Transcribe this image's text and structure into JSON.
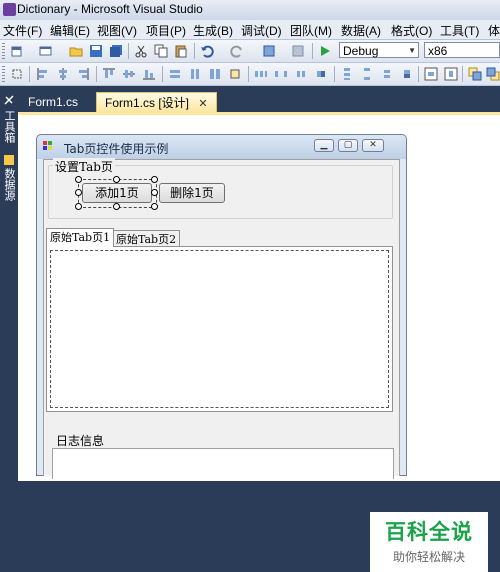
{
  "window": {
    "title": "Dictionary - Microsoft Visual Studio"
  },
  "menu": [
    "文件(F)",
    "编辑(E)",
    "视图(V)",
    "项目(P)",
    "生成(B)",
    "调试(D)",
    "团队(M)",
    "数据(A)",
    "格式(O)",
    "工具(T)",
    "体"
  ],
  "toolbar": {
    "config": "Debug",
    "platform": "x86"
  },
  "side_tabs": [
    "工具箱",
    "数据源"
  ],
  "doc_tabs": [
    {
      "label": "Form1.cs"
    },
    {
      "label": "Form1.cs [设计]",
      "close": "✕"
    }
  ],
  "form": {
    "title": "Tab页控件使用示例",
    "group_label": "设置Tab页",
    "add_button": "添加1页",
    "delete_button": "删除1页",
    "tabs": [
      "原始Tab页1",
      "原始Tab页2"
    ],
    "active_tab": 0,
    "log_label": "日志信息"
  },
  "watermark": {
    "main": "百科全说",
    "sub": "助你轻松解决"
  },
  "colors": {
    "accent_green": "#1aa34a",
    "ide_dark": "#2b3c59",
    "doc_tab_active": "#fce7a0"
  }
}
